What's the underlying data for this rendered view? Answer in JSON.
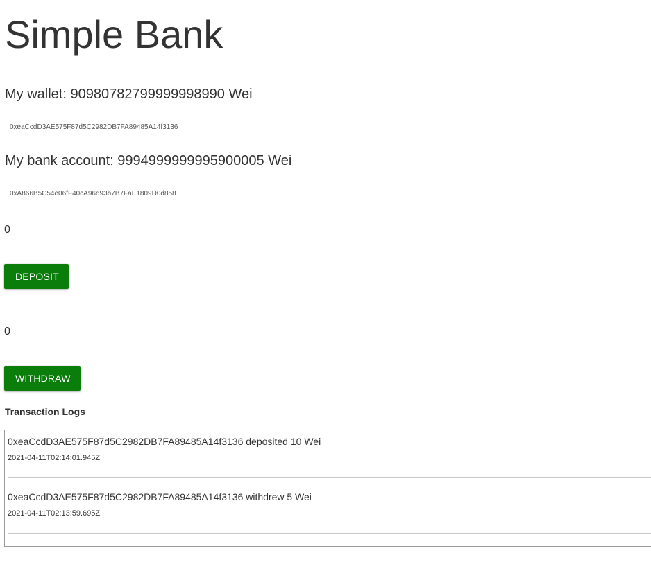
{
  "app": {
    "title": "Simple Bank"
  },
  "wallet": {
    "label": "My wallet: 90980782799999998990 Wei",
    "address": "0xeaCcdD3AE575F87d5C2982DB7FA89485A14f3136"
  },
  "bank_account": {
    "label": "My bank account: 9994999999995900005 Wei",
    "address": "0xA866B5C54e06fF40cA96d93b7B7FaE1809D0d858"
  },
  "deposit": {
    "amount_value": "0",
    "button_label": "DEPOSIT"
  },
  "withdraw": {
    "amount_value": "0",
    "button_label": "WITHDRAW"
  },
  "logs": {
    "heading": "Transaction Logs",
    "entries": [
      {
        "message": "0xeaCcdD3AE575F87d5C2982DB7FA89485A14f3136 deposited 10 Wei",
        "timestamp": "2021-04-11T02:14:01.945Z"
      },
      {
        "message": "0xeaCcdD3AE575F87d5C2982DB7FA89485A14f3136 withdrew 5 Wei",
        "timestamp": "2021-04-11T02:13:59.695Z"
      }
    ]
  },
  "colors": {
    "button_bg": "#0a7d0a",
    "button_text": "#ffffff",
    "text": "#333333"
  }
}
